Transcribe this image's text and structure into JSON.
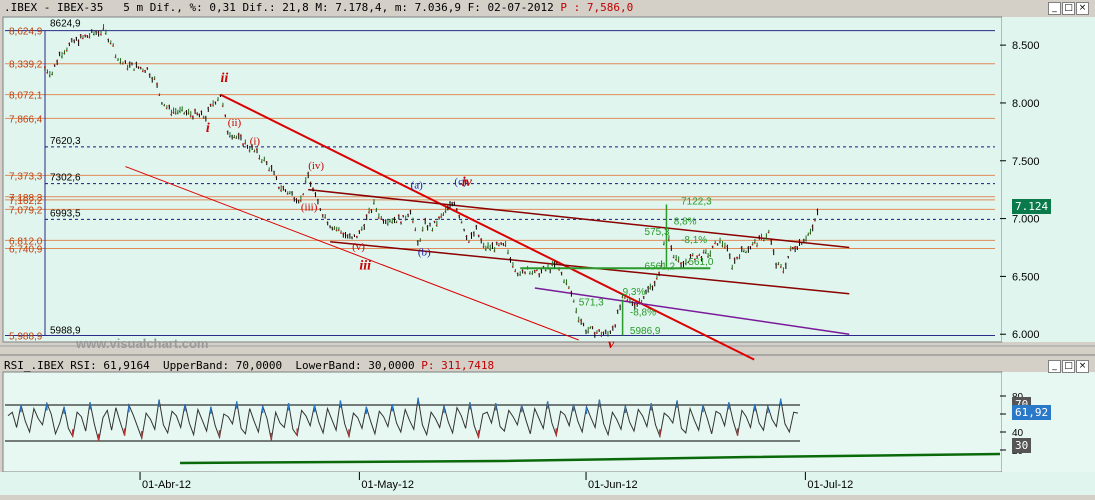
{
  "main_header": {
    "symbol": ".IBEX",
    "name": "IBEX-35",
    "interval": "5 m",
    "dif_label": "Dif.",
    "dif_pct": "%: 0,31",
    "dif_abs": "Dif.: 21,8",
    "max": "M: 7.178,4",
    "min": "m: 7.036,9",
    "date": "F: 02-07-2012",
    "price": "P : 7,586,0"
  },
  "rsi_header": {
    "text": "RSI_.IBEX RSI: 61,9164  UpperBand: 70,0000  LowerBand: 30,0000",
    "price": "P: 311,7418"
  },
  "watermark": "www.visualchart.com",
  "last_price_badge": "7.124",
  "rsi_badges": {
    "upper": "70",
    "value": "61,92",
    "lower": "30"
  },
  "colors": {
    "chart_bg": "#dff5ee",
    "fib_line": "#e08a5a",
    "channel_red": "#dd0000",
    "channel_dark": "#8b0000",
    "purple": "#7a1a9a",
    "green": "#2a9a2a",
    "blue_dashed": "#1a1a7a",
    "rsi_line": "#333333"
  },
  "chart_data": [
    {
      "type": "line",
      "subtype": "ohlc-bars",
      "x_range": [
        "2012-03-19",
        "2012-07-03"
      ],
      "ylim": [
        5950,
        8700
      ],
      "y_ticks": [
        "8.500",
        "8.000",
        "7.500",
        "7.000",
        "6.500",
        "6.000"
      ],
      "x_ticks": [
        "01-Abr-12",
        "01-May-12",
        "01-Jun-12",
        "01-Jul-12"
      ],
      "price_path": [
        {
          "x": "2012-03-19",
          "y": 8300
        },
        {
          "x": "2012-03-20",
          "y": 8260
        },
        {
          "x": "2012-03-21",
          "y": 8420
        },
        {
          "x": "2012-03-22",
          "y": 8480
        },
        {
          "x": "2012-03-23",
          "y": 8530
        },
        {
          "x": "2012-03-26",
          "y": 8610
        },
        {
          "x": "2012-03-27",
          "y": 8625
        },
        {
          "x": "2012-03-28",
          "y": 8540
        },
        {
          "x": "2012-03-29",
          "y": 8380
        },
        {
          "x": "2012-03-30",
          "y": 8330
        },
        {
          "x": "2012-04-02",
          "y": 8290
        },
        {
          "x": "2012-04-03",
          "y": 8200
        },
        {
          "x": "2012-04-04",
          "y": 8020
        },
        {
          "x": "2012-04-05",
          "y": 7940
        },
        {
          "x": "2012-04-10",
          "y": 7880
        },
        {
          "x": "2012-04-11",
          "y": 8000
        },
        {
          "x": "2012-04-12",
          "y": 8072
        },
        {
          "x": "2012-04-13",
          "y": 7760
        },
        {
          "x": "2012-04-16",
          "y": 7620
        },
        {
          "x": "2012-04-17",
          "y": 7560
        },
        {
          "x": "2012-04-18",
          "y": 7500
        },
        {
          "x": "2012-04-19",
          "y": 7420
        },
        {
          "x": "2012-04-20",
          "y": 7280
        },
        {
          "x": "2012-04-23",
          "y": 7160
        },
        {
          "x": "2012-04-24",
          "y": 7373
        },
        {
          "x": "2012-04-25",
          "y": 7180
        },
        {
          "x": "2012-04-26",
          "y": 7050
        },
        {
          "x": "2012-04-27",
          "y": 6950
        },
        {
          "x": "2012-04-30",
          "y": 6820
        },
        {
          "x": "2012-05-01",
          "y": 6870
        },
        {
          "x": "2012-05-02",
          "y": 7000
        },
        {
          "x": "2012-05-03",
          "y": 7120
        },
        {
          "x": "2012-05-04",
          "y": 7000
        },
        {
          "x": "2012-05-07",
          "y": 6990
        },
        {
          "x": "2012-05-08",
          "y": 7080
        },
        {
          "x": "2012-05-09",
          "y": 6780
        },
        {
          "x": "2012-05-10",
          "y": 6950
        },
        {
          "x": "2012-05-11",
          "y": 6920
        },
        {
          "x": "2012-05-14",
          "y": 7150
        },
        {
          "x": "2012-05-15",
          "y": 6980
        },
        {
          "x": "2012-05-16",
          "y": 6800
        },
        {
          "x": "2012-05-17",
          "y": 6900
        },
        {
          "x": "2012-05-18",
          "y": 6750
        },
        {
          "x": "2012-05-21",
          "y": 6760
        },
        {
          "x": "2012-05-22",
          "y": 6620
        },
        {
          "x": "2012-05-23",
          "y": 6500
        },
        {
          "x": "2012-05-24",
          "y": 6580
        },
        {
          "x": "2012-05-25",
          "y": 6520
        },
        {
          "x": "2012-05-28",
          "y": 6600
        },
        {
          "x": "2012-05-29",
          "y": 6480
        },
        {
          "x": "2012-05-30",
          "y": 6350
        },
        {
          "x": "2012-05-31",
          "y": 6150
        },
        {
          "x": "2012-06-01",
          "y": 6040
        },
        {
          "x": "2012-06-04",
          "y": 6000
        },
        {
          "x": "2012-06-05",
          "y": 6100
        },
        {
          "x": "2012-06-06",
          "y": 6300
        },
        {
          "x": "2012-06-07",
          "y": 6280
        },
        {
          "x": "2012-06-08",
          "y": 6260
        },
        {
          "x": "2012-06-11",
          "y": 6500
        },
        {
          "x": "2012-06-12",
          "y": 6900
        },
        {
          "x": "2012-06-13",
          "y": 6700
        },
        {
          "x": "2012-06-14",
          "y": 6580
        },
        {
          "x": "2012-06-15",
          "y": 6650
        },
        {
          "x": "2012-06-18",
          "y": 6700
        },
        {
          "x": "2012-06-19",
          "y": 6800
        },
        {
          "x": "2012-06-20",
          "y": 6780
        },
        {
          "x": "2012-06-21",
          "y": 6600
        },
        {
          "x": "2012-06-22",
          "y": 6700
        },
        {
          "x": "2012-06-25",
          "y": 6820
        },
        {
          "x": "2012-06-26",
          "y": 6880
        },
        {
          "x": "2012-06-27",
          "y": 6600
        },
        {
          "x": "2012-06-28",
          "y": 6560
        },
        {
          "x": "2012-06-29",
          "y": 6720
        },
        {
          "x": "2012-07-02",
          "y": 6900
        },
        {
          "x": "2012-07-03",
          "y": 7140
        }
      ],
      "fib_levels": [
        {
          "label": "8,624,9",
          "y": 8624.9
        },
        {
          "label": "8,339,2",
          "y": 8339.2
        },
        {
          "label": "8,072,1",
          "y": 8072.1
        },
        {
          "label": "7,866,4",
          "y": 7866.4
        },
        {
          "label": "7,373,3",
          "y": 7373.3
        },
        {
          "label": "7,188,3",
          "y": 7188.3
        },
        {
          "label": "7,162,2",
          "y": 7162.2
        },
        {
          "label": "7,079,2",
          "y": 7079.2
        },
        {
          "label": "6,812,0",
          "y": 6812.0
        },
        {
          "label": "6,740,9",
          "y": 6740.9
        },
        {
          "label": "5,988,9",
          "y": 5988.9
        }
      ],
      "dashed_levels": [
        {
          "label": "7620,3",
          "y": 7620.3
        },
        {
          "label": "7302,6",
          "y": 7302.6
        },
        {
          "label": "6993,5",
          "y": 6993.5
        }
      ],
      "top_label": {
        "text": "8624,9",
        "y": 8624.9
      },
      "bottom_label": {
        "text": "5988,9",
        "y": 5988.9
      },
      "channel_lines": [
        {
          "color": "channel_red",
          "width": 2,
          "from": {
            "x": "2012-04-12",
            "y": 8072
          },
          "to": {
            "x": "2012-06-24",
            "y": 5780
          }
        },
        {
          "color": "channel_red",
          "width": 1,
          "from": {
            "x": "2012-03-30",
            "y": 7450
          },
          "to": {
            "x": "2012-05-31",
            "y": 5950
          }
        },
        {
          "color": "channel_dark",
          "width": 1.5,
          "from": {
            "x": "2012-04-24",
            "y": 7250
          },
          "to": {
            "x": "2012-07-07",
            "y": 6750
          }
        },
        {
          "color": "channel_dark",
          "width": 1.5,
          "from": {
            "x": "2012-04-27",
            "y": 6800
          },
          "to": {
            "x": "2012-07-07",
            "y": 6350
          }
        },
        {
          "color": "purple",
          "width": 1.5,
          "from": {
            "x": "2012-05-25",
            "y": 6400
          },
          "to": {
            "x": "2012-07-07",
            "y": 6000
          }
        }
      ],
      "wave_labels": [
        {
          "text": "ii",
          "x": "2012-04-12",
          "y": 8180,
          "color": "#cc0000",
          "style": "bold-italic"
        },
        {
          "text": "i",
          "x": "2012-04-10",
          "y": 7750,
          "color": "#cc0000",
          "style": "bold-italic"
        },
        {
          "text": "(ii)",
          "x": "2012-04-13",
          "y": 7800,
          "color": "#cc0000",
          "style": "normal"
        },
        {
          "text": "(i)",
          "x": "2012-04-16",
          "y": 7640,
          "color": "#cc0000",
          "style": "normal"
        },
        {
          "text": "(iv)",
          "x": "2012-04-24",
          "y": 7430,
          "color": "#cc0000",
          "style": "normal"
        },
        {
          "text": "(iii)",
          "x": "2012-04-23",
          "y": 7070,
          "color": "#cc0000",
          "style": "normal"
        },
        {
          "text": "(v)",
          "x": "2012-04-30",
          "y": 6730,
          "color": "#cc0000",
          "style": "normal"
        },
        {
          "text": "iii",
          "x": "2012-05-01",
          "y": 6560,
          "color": "#cc0000",
          "style": "bold-italic"
        },
        {
          "text": "(a)",
          "x": "2012-05-08",
          "y": 7260,
          "color": "#1a1aaa",
          "style": "normal"
        },
        {
          "text": "(b)",
          "x": "2012-05-09",
          "y": 6680,
          "color": "#1a1aaa",
          "style": "normal"
        },
        {
          "text": "(c)",
          "x": "2012-05-14",
          "y": 7290,
          "color": "#1a1aaa",
          "style": "normal"
        },
        {
          "text": "iv",
          "x": "2012-05-15",
          "y": 7280,
          "color": "#cc0000",
          "style": "bold-italic"
        },
        {
          "text": "v",
          "x": "2012-06-04",
          "y": 5880,
          "color": "#cc0000",
          "style": "bold-italic"
        }
      ],
      "green_annotations": [
        {
          "text": "7122,3",
          "x": "2012-06-14",
          "y": 7120
        },
        {
          "text": "8,8%",
          "x": "2012-06-13",
          "y": 6950
        },
        {
          "text": "575,3",
          "x": "2012-06-09",
          "y": 6860
        },
        {
          "text": "-8,1%",
          "x": "2012-06-14",
          "y": 6790
        },
        {
          "text": "6561,2",
          "x": "2012-06-09",
          "y": 6560
        },
        {
          "text": "561,0",
          "x": "2012-06-15",
          "y": 6600
        },
        {
          "text": "9,3%",
          "x": "2012-06-06",
          "y": 6340
        },
        {
          "text": "571,3",
          "x": "2012-05-31",
          "y": 6250
        },
        {
          "text": "-8,8%",
          "x": "2012-06-07",
          "y": 6160
        },
        {
          "text": "5986,9",
          "x": "2012-06-07",
          "y": 6000
        }
      ]
    },
    {
      "type": "line",
      "subtype": "rsi",
      "ylim": [
        0,
        100
      ],
      "y_ticks": [
        "80",
        "60",
        "40",
        "20"
      ],
      "upper_band": 70,
      "lower_band": 30,
      "last_value": 61.92,
      "series_values": [
        58,
        62,
        45,
        70,
        52,
        40,
        66,
        55,
        48,
        72,
        60,
        38,
        50,
        68,
        44,
        35,
        62,
        57,
        41,
        73,
        49,
        30,
        56,
        64,
        42,
        67,
        51,
        36,
        70,
        59,
        46,
        33,
        61,
        54,
        43,
        76,
        48,
        39,
        63,
        58,
        45,
        71,
        50,
        37,
        65,
        53,
        41,
        68,
        47,
        34,
        60,
        57,
        49,
        74,
        44,
        38,
        66,
        52,
        40,
        69,
        55,
        31,
        62,
        50,
        45,
        72,
        43,
        36,
        64,
        58,
        47,
        70,
        51,
        39,
        66,
        54,
        42,
        75,
        49,
        35,
        61,
        56,
        44,
        68,
        52,
        38,
        63,
        57,
        46,
        71,
        50,
        40,
        65,
        53,
        43,
        78,
        48,
        37,
        62,
        55,
        45,
        69,
        51,
        39,
        67,
        58,
        44,
        73,
        47,
        34,
        60,
        62,
        50,
        72,
        46,
        41,
        64,
        57,
        48,
        70,
        53,
        38,
        66,
        55,
        44,
        74,
        50,
        36,
        63,
        59,
        47,
        71,
        52,
        40,
        68,
        56,
        45,
        76,
        49,
        37,
        62,
        54,
        43,
        69,
        51,
        41,
        65,
        58,
        46,
        72,
        48,
        35,
        61,
        57,
        50,
        75,
        44,
        39,
        66,
        53,
        42,
        70,
        55,
        38,
        63,
        60,
        47,
        73,
        52,
        36,
        64,
        57,
        45,
        71,
        50,
        42,
        69,
        54,
        46,
        77,
        49,
        40,
        62,
        61
      ]
    }
  ]
}
